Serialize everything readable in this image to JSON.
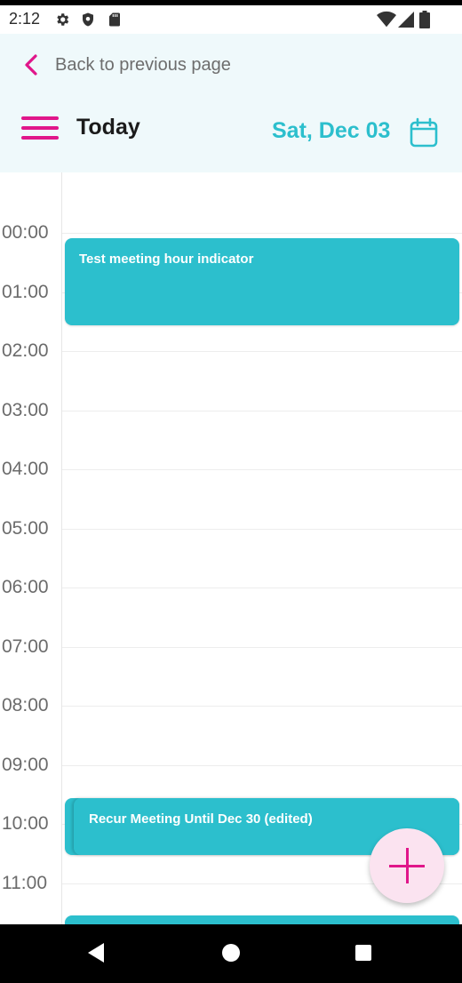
{
  "status_bar": {
    "time": "2:12",
    "left_icons": [
      "gear-icon",
      "shield-icon",
      "sd-card-icon"
    ],
    "right_icons": [
      "wifi-icon",
      "signal-icon",
      "battery-icon"
    ]
  },
  "header": {
    "back_label": "Back to previous page",
    "title": "Today",
    "date": "Sat, Dec 03"
  },
  "calendar": {
    "hours": [
      "00:00",
      "01:00",
      "02:00",
      "03:00",
      "04:00",
      "05:00",
      "06:00",
      "07:00",
      "08:00",
      "09:00",
      "10:00",
      "11:00"
    ],
    "events": [
      {
        "title": "Test meeting hour indicator"
      },
      {
        "title": "Recur Meeting Until Dec 30 (edited)"
      },
      {
        "title": ""
      }
    ]
  },
  "colors": {
    "accent_pink": "#e0168a",
    "accent_teal": "#2cbfcd",
    "header_bg": "#eff9fb",
    "fab_bg": "#fbe3f0"
  },
  "fab": {
    "icon": "plus-icon"
  },
  "nav_bar": {
    "buttons": [
      "back-triangle-icon",
      "home-circle-icon",
      "recents-square-icon"
    ]
  }
}
